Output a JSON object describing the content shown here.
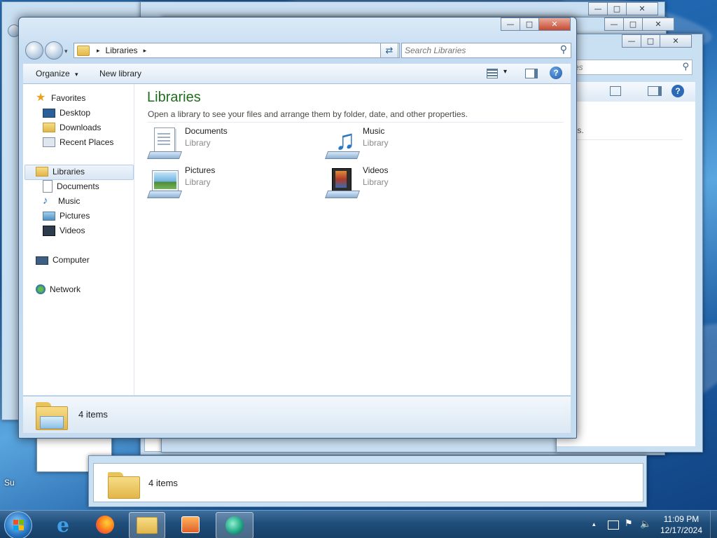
{
  "window": {
    "breadcrumb_root_arrow": "▸",
    "breadcrumb": "Libraries",
    "breadcrumb_tail_arrow": "▸",
    "search_placeholder": "Search Libraries",
    "controls": {
      "minimize": "—",
      "maximize": "□",
      "close": "✕"
    }
  },
  "toolbar": {
    "organize_label": "Organize",
    "organize_arrow": "▾",
    "new_library_label": "New library",
    "views_arrow": "▾",
    "help_label": "?"
  },
  "nav": {
    "favorites": {
      "label": "Favorites",
      "items": [
        "Desktop",
        "Downloads",
        "Recent Places"
      ]
    },
    "libraries": {
      "label": "Libraries",
      "items": [
        "Documents",
        "Music",
        "Pictures",
        "Videos"
      ]
    },
    "computer": "Computer",
    "network": "Network"
  },
  "content": {
    "title": "Libraries",
    "subtitle": "Open a library to see your files and arrange them by folder, date, and other properties.",
    "items": [
      {
        "name": "Documents",
        "type": "Library"
      },
      {
        "name": "Music",
        "type": "Library"
      },
      {
        "name": "Pictures",
        "type": "Library"
      },
      {
        "name": "Videos",
        "type": "Library"
      }
    ]
  },
  "status": {
    "count": "4 items"
  },
  "background_windows": {
    "status_count": "4 items",
    "partial_text": "ies.",
    "partial_search": "es"
  },
  "desktop": {
    "partial_icon_label": "Su"
  },
  "taskbar": {
    "start_icon": "windows-orb-icon",
    "pinned": [
      "internet-explorer-icon",
      "firefox-icon",
      "explorer-folder-icon",
      "media-player-icon",
      "app-icon"
    ],
    "clock_time": "11:09 PM",
    "clock_date": "12/17/2024",
    "tray_arrow": "▴"
  },
  "colors": {
    "title_green": "#1e6e1e",
    "taskbar": "#1f4d7a",
    "accent": "#2a78c4"
  }
}
